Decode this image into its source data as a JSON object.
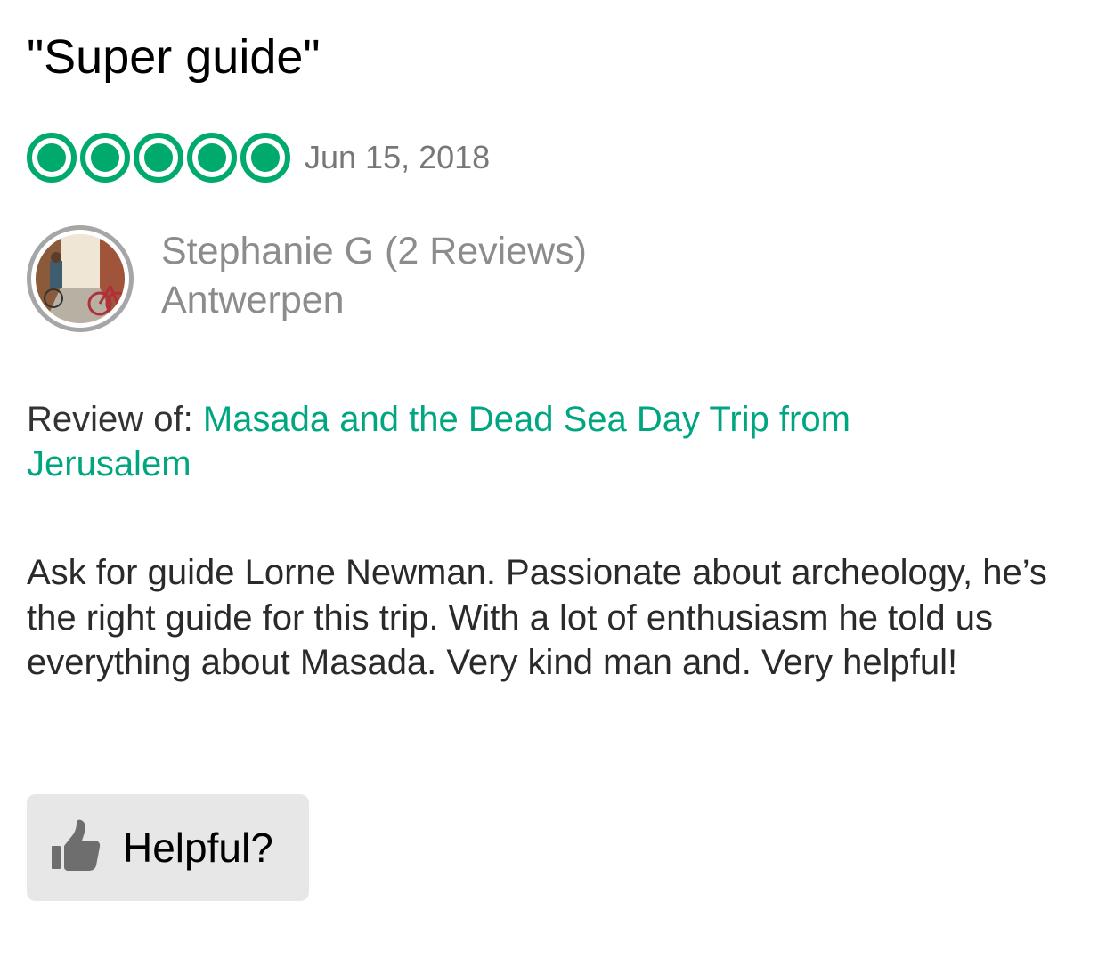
{
  "review": {
    "title": "\"Super guide\"",
    "rating": 5,
    "rating_max": 5,
    "date": "Jun 15, 2018",
    "reviewer_name": "Stephanie G (2 Reviews)",
    "reviewer_location": "Antwerpen",
    "review_of_label": "Review of: ",
    "review_of_link": "Masada and the Dead Sea Day Trip from Jerusalem",
    "text": "Ask for guide Lorne Newman. Passionate about archeology, he’s the right guide for this trip. With a lot of enthusiasm he told us everything about Masada. Very kind man and. Very helpful!",
    "helpful_label": "Helpful?"
  },
  "icons": {
    "avatar": "user-avatar-photo",
    "thumb": "thumbs-up-icon",
    "rating": "rating-bubble-icon"
  },
  "colors": {
    "accent_green": "#00aa6c",
    "link_green": "#00a680",
    "muted_text": "#8c8c8c",
    "button_bg": "#e7e7e7"
  }
}
